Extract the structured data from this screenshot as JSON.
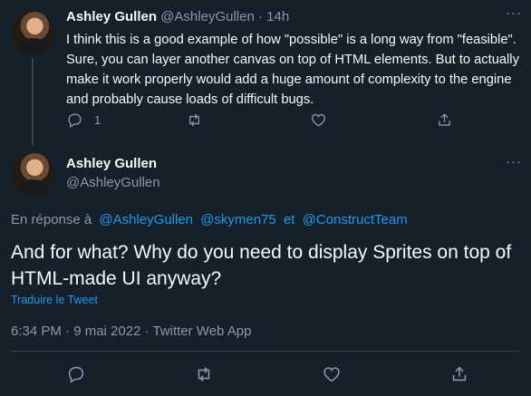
{
  "parent_tweet": {
    "name": "Ashley Gullen",
    "handle": "@AshleyGullen",
    "separator": "·",
    "time": "14h",
    "more": "···",
    "text": "I think this is a good example of how \"possible\" is a long way from \"feasible\". Sure, you can layer another canvas on top of HTML elements. But to actually make it work properly would add a huge amount of complexity to the engine and probably cause loads of difficult bugs.",
    "reply_count": "1"
  },
  "main_tweet": {
    "name": "Ashley Gullen",
    "handle": "@AshleyGullen",
    "more": "···",
    "replying_prefix": "En réponse à",
    "replying_to": [
      "@AshleyGullen",
      "@skymen75",
      "et",
      "@ConstructTeam"
    ],
    "text": "And for what? Why do you need to display Sprites on top of HTML-made UI anyway?",
    "translate_label": "Traduire le Tweet",
    "meta": "6:34 PM · 9 mai 2022 · Twitter Web App"
  },
  "icons": [
    "reply-icon",
    "retweet-icon",
    "like-icon",
    "share-icon"
  ],
  "colors": {
    "background": "#15202b",
    "text": "#f7f9f9",
    "muted": "#8b98a5",
    "accent": "#1d9bf0",
    "border": "#38444d"
  }
}
